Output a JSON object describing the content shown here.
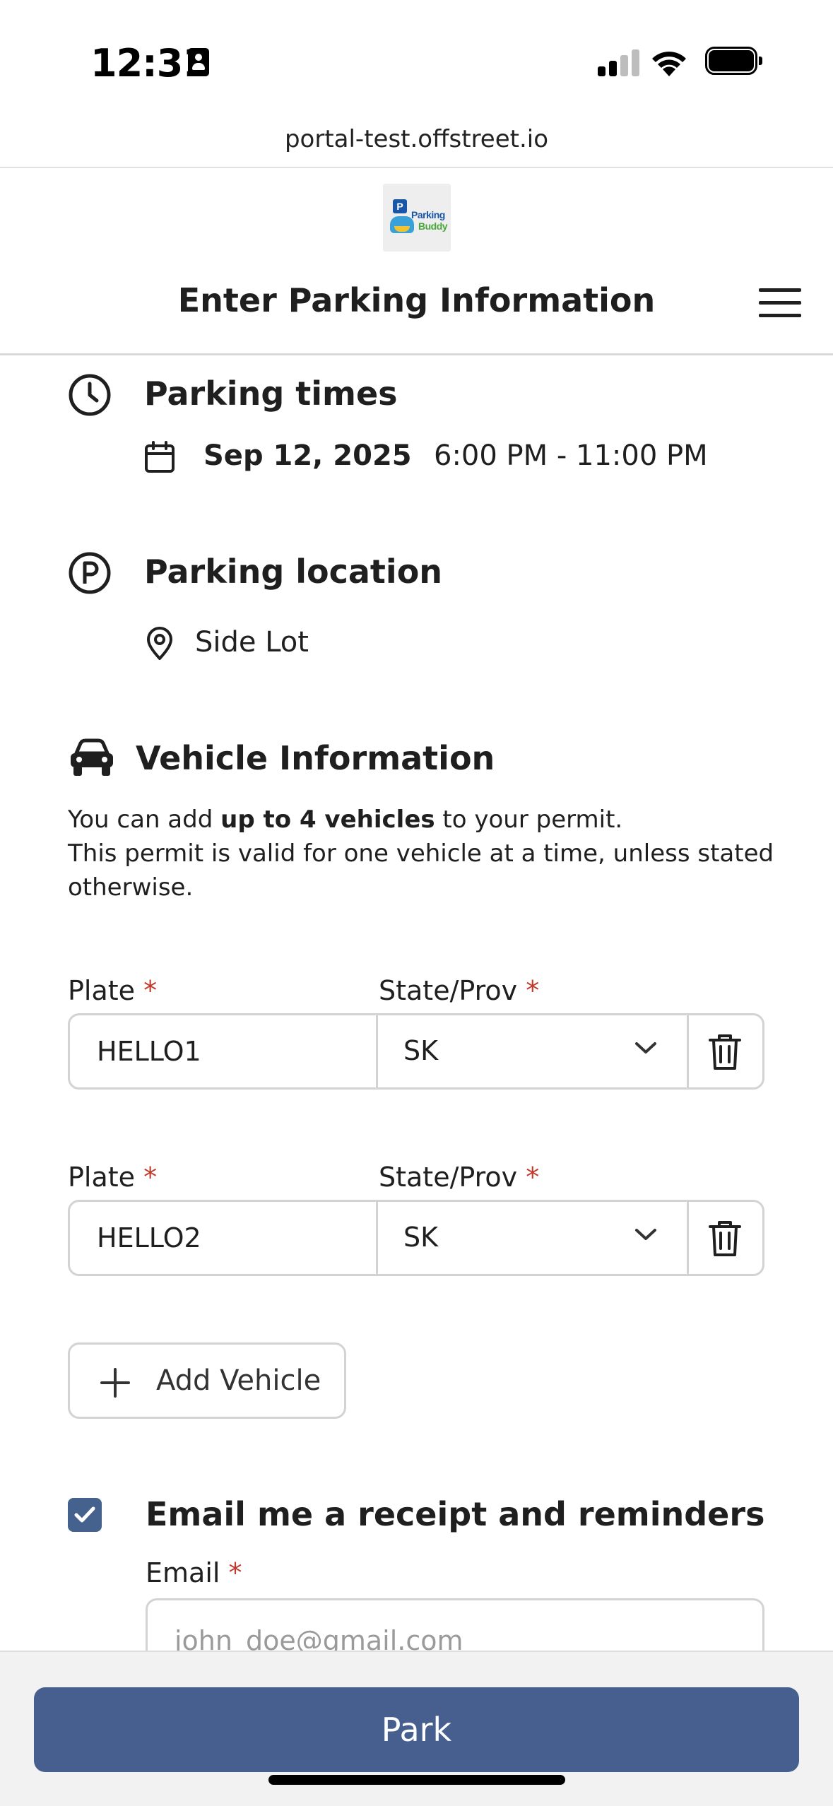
{
  "status_bar": {
    "time": "12:31",
    "icons": [
      "contact-card-icon",
      "cellular-signal-icon",
      "wifi-icon",
      "battery-icon"
    ]
  },
  "browser": {
    "url": "portal-test.offstreet.io"
  },
  "header": {
    "logo_text_line1": "Parking",
    "logo_text_line2": "Buddy",
    "logo_badge": "P",
    "title": "Enter Parking Information"
  },
  "parking_times": {
    "title": "Parking times",
    "date": "Sep 12, 2025",
    "time_range": "6:00 PM - 11:00 PM"
  },
  "parking_location": {
    "title": "Parking location",
    "location": "Side Lot"
  },
  "vehicle_info": {
    "title": "Vehicle Information",
    "desc_pre": "You can add ",
    "desc_bold": "up to 4 vehicles",
    "desc_post": " to your permit.",
    "desc_line2": "This permit is valid for one vehicle at a time, unless stated",
    "desc_line3": "otherwise.",
    "plate_label": "Plate",
    "state_label": "State/Prov",
    "required_mark": "*",
    "vehicles": [
      {
        "plate": "HELLO1",
        "state": "SK"
      },
      {
        "plate": "HELLO2",
        "state": "SK"
      }
    ],
    "add_vehicle_label": "Add Vehicle"
  },
  "email": {
    "checkbox_label": "Email me a receipt and reminders",
    "checked": true,
    "field_label": "Email",
    "placeholder": "john_doe@gmail.com",
    "value": ""
  },
  "footer": {
    "park_label": "Park"
  },
  "colors": {
    "primary": "#465f8f",
    "required": "#c0392b",
    "border": "#d3d3d3",
    "text": "#1f1f1f"
  }
}
